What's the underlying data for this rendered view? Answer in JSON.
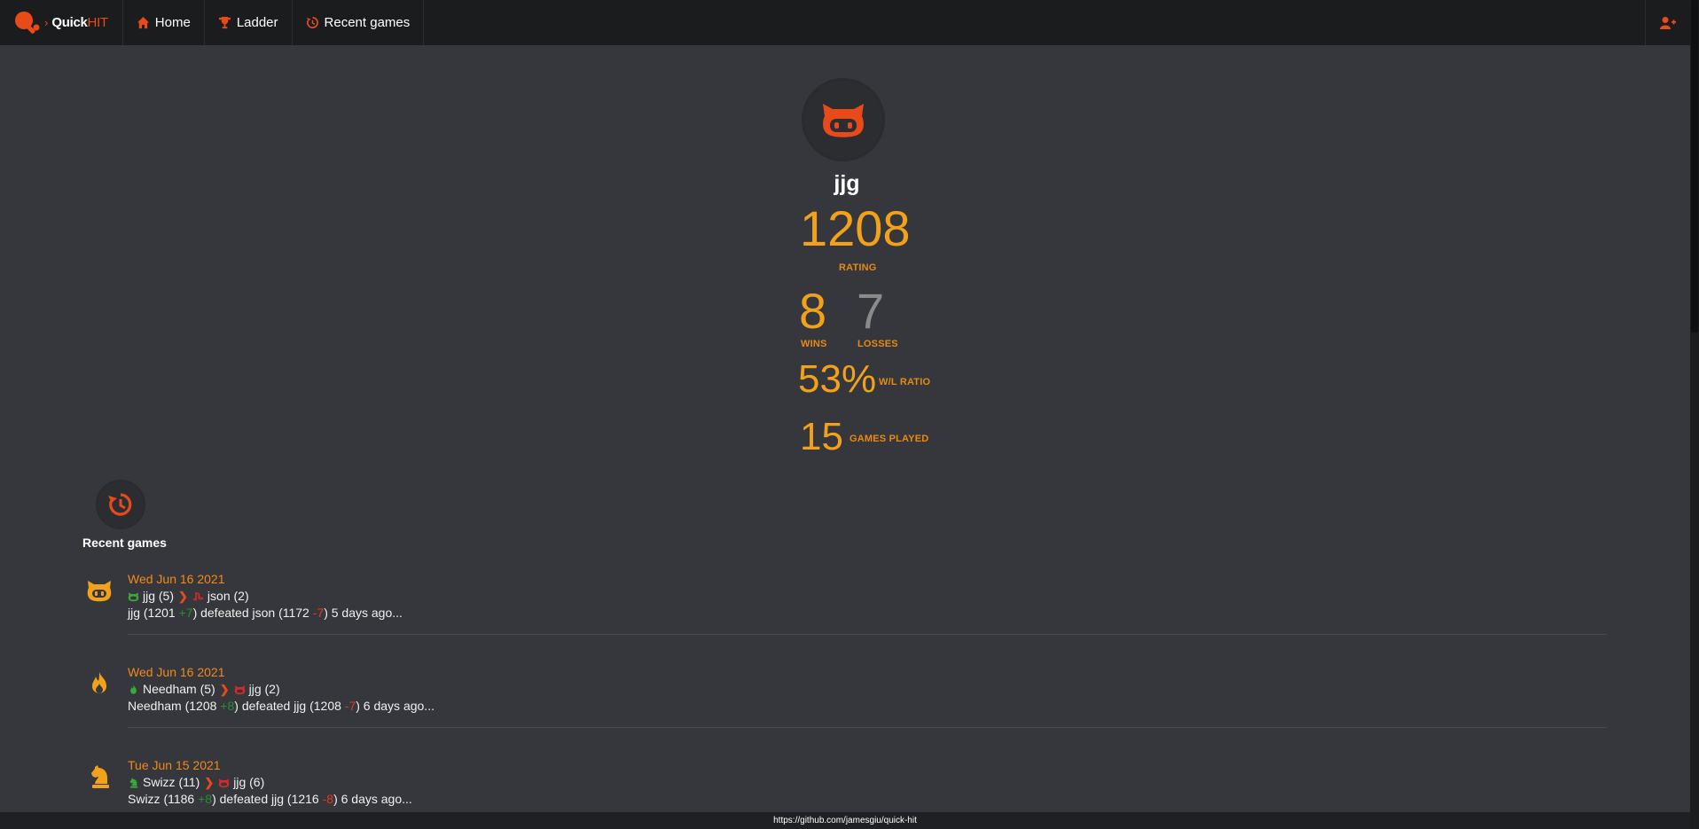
{
  "brand": {
    "name_part1": "Quick",
    "name_part2": "HIT",
    "caret": "›"
  },
  "nav": [
    {
      "label": "Home",
      "icon": "home-icon"
    },
    {
      "label": "Ladder",
      "icon": "trophy-icon"
    },
    {
      "label": "Recent games",
      "icon": "history-icon"
    }
  ],
  "nav_right_icon": "add-user-icon",
  "profile": {
    "name": "jjg",
    "avatar_icon": "robot-face-icon",
    "rating": "1208",
    "rating_label": "RATING",
    "wins": "8",
    "wins_label": "WINS",
    "losses": "7",
    "losses_label": "LOSSES",
    "ratio": "53%",
    "ratio_label": "W/L RATIO",
    "played": "15",
    "played_label": "GAMES PLAYED"
  },
  "recent": {
    "title": "Recent games",
    "games": [
      {
        "icon": "robot-face-icon",
        "date": "Wed Jun 16 2021",
        "winner": "jjg (5)",
        "winner_icon": "robot-face-icon",
        "loser": "json (2)",
        "loser_icon": "playstation-icon",
        "summary_winner": "jjg (1201 ",
        "winner_delta": "+7",
        "summary_mid": ") defeated json (1172 ",
        "loser_delta": "-7",
        "summary_end": ") 5 days ago..."
      },
      {
        "icon": "fire-icon",
        "date": "Wed Jun 16 2021",
        "winner": "Needham (5)",
        "winner_icon": "fire-icon",
        "loser": "jjg (2)",
        "loser_icon": "robot-face-icon",
        "summary_winner": "Needham (1208 ",
        "winner_delta": "+8",
        "summary_mid": ") defeated jjg (1208 ",
        "loser_delta": "-7",
        "summary_end": ") 6 days ago..."
      },
      {
        "icon": "chess-knight-icon",
        "date": "Tue Jun 15 2021",
        "winner": "Swizz (11)",
        "winner_icon": "chess-knight-icon",
        "loser": "jjg (6)",
        "loser_icon": "robot-face-icon",
        "summary_winner": "Swizz (1186 ",
        "winner_delta": "+8",
        "summary_mid": ") defeated jjg (1216 ",
        "loser_delta": "-8",
        "summary_end": ") 6 days ago..."
      }
    ]
  },
  "footer": {
    "link": "https://github.com/jamesgiu/quick-hit"
  },
  "colors": {
    "accent": "#e84a1a",
    "stat": "#f2a21a",
    "win": "#2e8b2e",
    "loss": "#e23a20"
  }
}
